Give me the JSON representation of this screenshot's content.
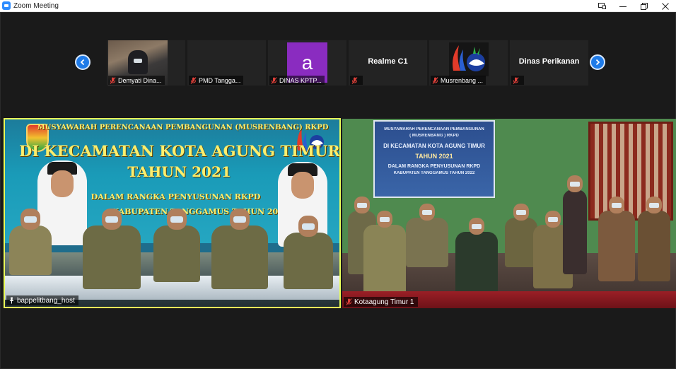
{
  "window": {
    "title": "Zoom Meeting",
    "controls": [
      "restore-view-icon",
      "minimize-icon",
      "maximize-icon",
      "close-icon"
    ]
  },
  "thumbnails": [
    {
      "name": "Demyati Dina...",
      "muted": true,
      "kind": "video"
    },
    {
      "name": "PMD Tangga...",
      "muted": true,
      "kind": "blank"
    },
    {
      "name": "DINAS KPTP...",
      "muted": true,
      "kind": "avatar",
      "avatar_letter": "a",
      "avatar_color": "#8a2cc0"
    },
    {
      "name": "",
      "display_name": "Realme C1",
      "muted": true,
      "kind": "name"
    },
    {
      "name": "Musrenbang ...",
      "muted": true,
      "kind": "logo"
    },
    {
      "name": "",
      "display_name": "Dinas Perikanan",
      "muted": true,
      "kind": "name"
    }
  ],
  "main_videos": [
    {
      "label": "bappelitbang_host",
      "highlighted": true,
      "highlight_color": "#e9ff59",
      "banner_lines": [
        "MUSYAWARAH PERENCANAAN PEMBANGUNAN (MUSRENBANG) RKPD",
        "DI KECAMATAN KOTA AGUNG TIMUR",
        "TAHUN 2021",
        "DALAM RANGKA PENYUSUNAN RKPD",
        "KABUPATEN TANGGAMUS TAHUN 2022"
      ]
    },
    {
      "label": "Kotaagung Timur 1",
      "highlighted": false,
      "screen_lines": [
        "MUSYAWARAH PERENCANAAN PEMBANGUNAN",
        "( MUSRENBANG ) RKPD",
        "DI KECAMATAN KOTA AGUNG TIMUR",
        "TAHUN 2021",
        "DALAM RANGKA PENYUSUNAN RKPD",
        "KABUPATEN TANGGAMUS TAHUN 2022"
      ]
    }
  ],
  "colors": {
    "accent": "#1f7be8",
    "background": "#1a1a1a",
    "mute_red": "#e0403a"
  }
}
